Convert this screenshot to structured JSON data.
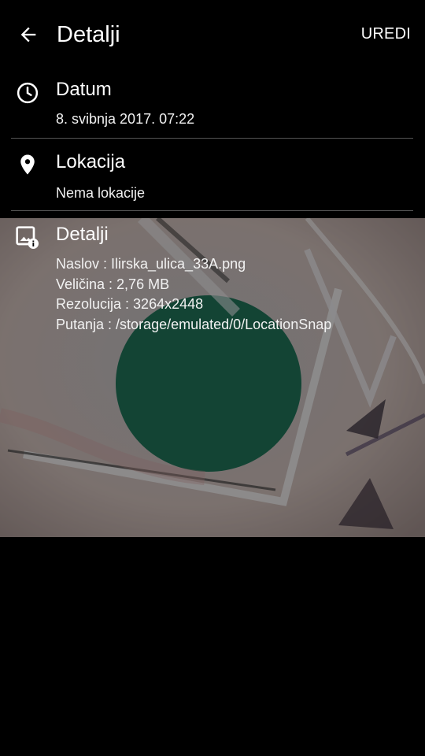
{
  "appbar": {
    "title": "Detalji",
    "action_label": "UREDI"
  },
  "date_section": {
    "icon": "clock-icon",
    "title": "Datum",
    "value": "8. svibnja 2017. 07:22"
  },
  "location_section": {
    "icon": "location-pin-icon",
    "title": "Lokacija",
    "value": "Nema lokacije"
  },
  "details_section": {
    "icon": "image-info-icon",
    "title": "Detalji",
    "lines": [
      "Naslov : Ilirska_ulica_33A.png",
      "Veličina : 2,76 MB",
      "Rezolucija : 3264x2448",
      "Putanja : /storage/emulated/0/LocationSnap"
    ]
  },
  "colors": {
    "background": "#000000",
    "divider": "#555555",
    "text": "#ffffff"
  }
}
